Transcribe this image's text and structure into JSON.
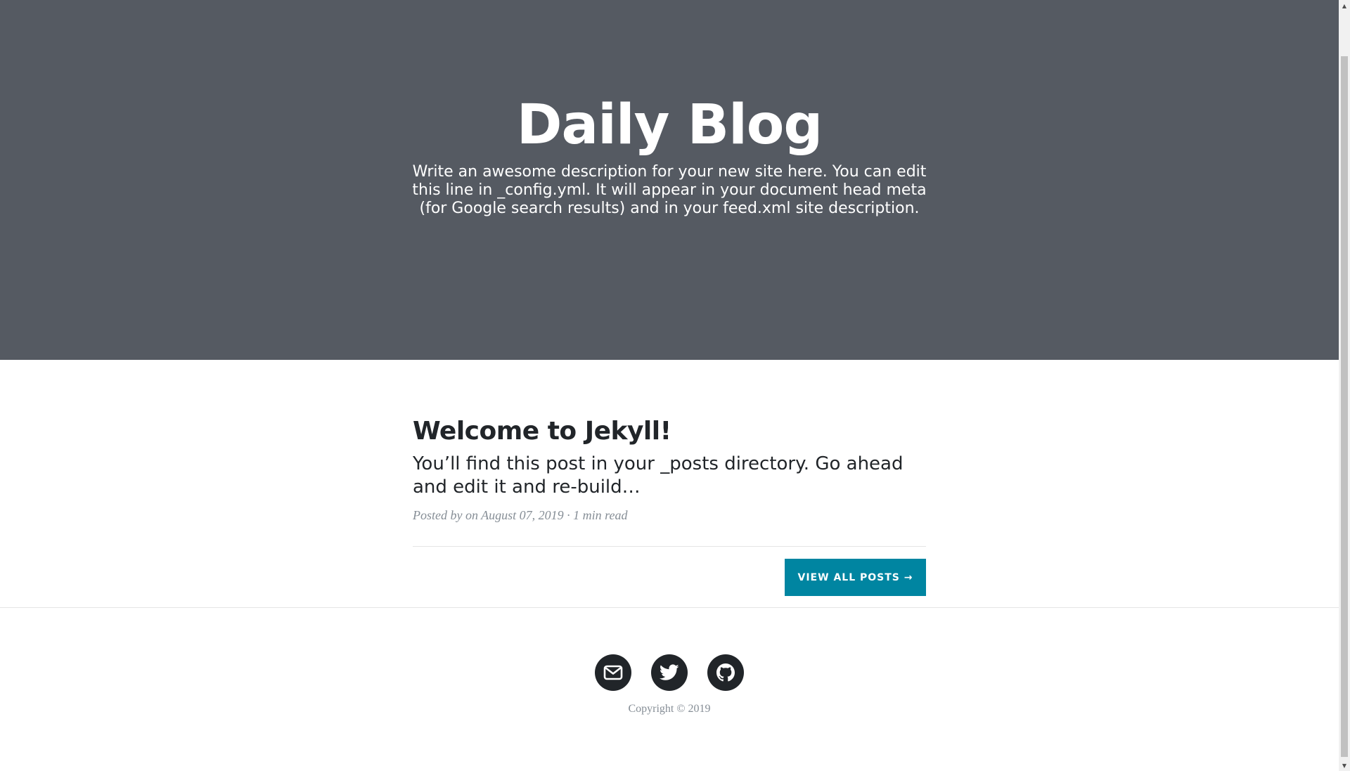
{
  "header": {
    "title": "Daily Blog",
    "description": "Write an awesome description for your new site here. You can edit this line in _config.yml. It will appear in your document head meta (for Google search results) and in your feed.xml site description."
  },
  "post": {
    "title": "Welcome to Jekyll!",
    "subtitle": "You’ll find this post in your _posts directory. Go ahead and edit it and re-build…",
    "meta": "Posted by on August 07, 2019 · 1 min read"
  },
  "pager": {
    "view_all_label": "VIEW ALL POSTS →"
  },
  "footer": {
    "social_icons": [
      "envelope-icon",
      "twitter-icon",
      "github-icon"
    ],
    "copyright": "Copyright © 2019"
  },
  "colors": {
    "masthead_bg": "#555a62",
    "accent": "#0085a1",
    "text_dark": "#212529",
    "text_muted": "#868e96"
  }
}
